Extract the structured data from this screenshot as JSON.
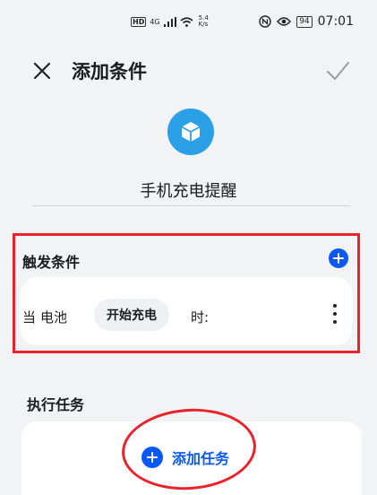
{
  "status_bar": {
    "hd": "HD",
    "signal": "4G",
    "speed_value": "5.4",
    "speed_unit": "K/s",
    "battery": "94",
    "time": "07:01"
  },
  "header": {
    "title": "添加条件"
  },
  "rule": {
    "name": "手机充电提醒",
    "icon": "cube-icon",
    "icon_color": "#2ca0e6"
  },
  "trigger": {
    "title": "触发条件",
    "when": "当",
    "device": "电池",
    "condition": "开始充电",
    "suffix": "时:"
  },
  "task": {
    "title": "执行任务",
    "add_label": "添加任务"
  },
  "colors": {
    "accent": "#0a59f7",
    "annotation": "#e8232b"
  }
}
